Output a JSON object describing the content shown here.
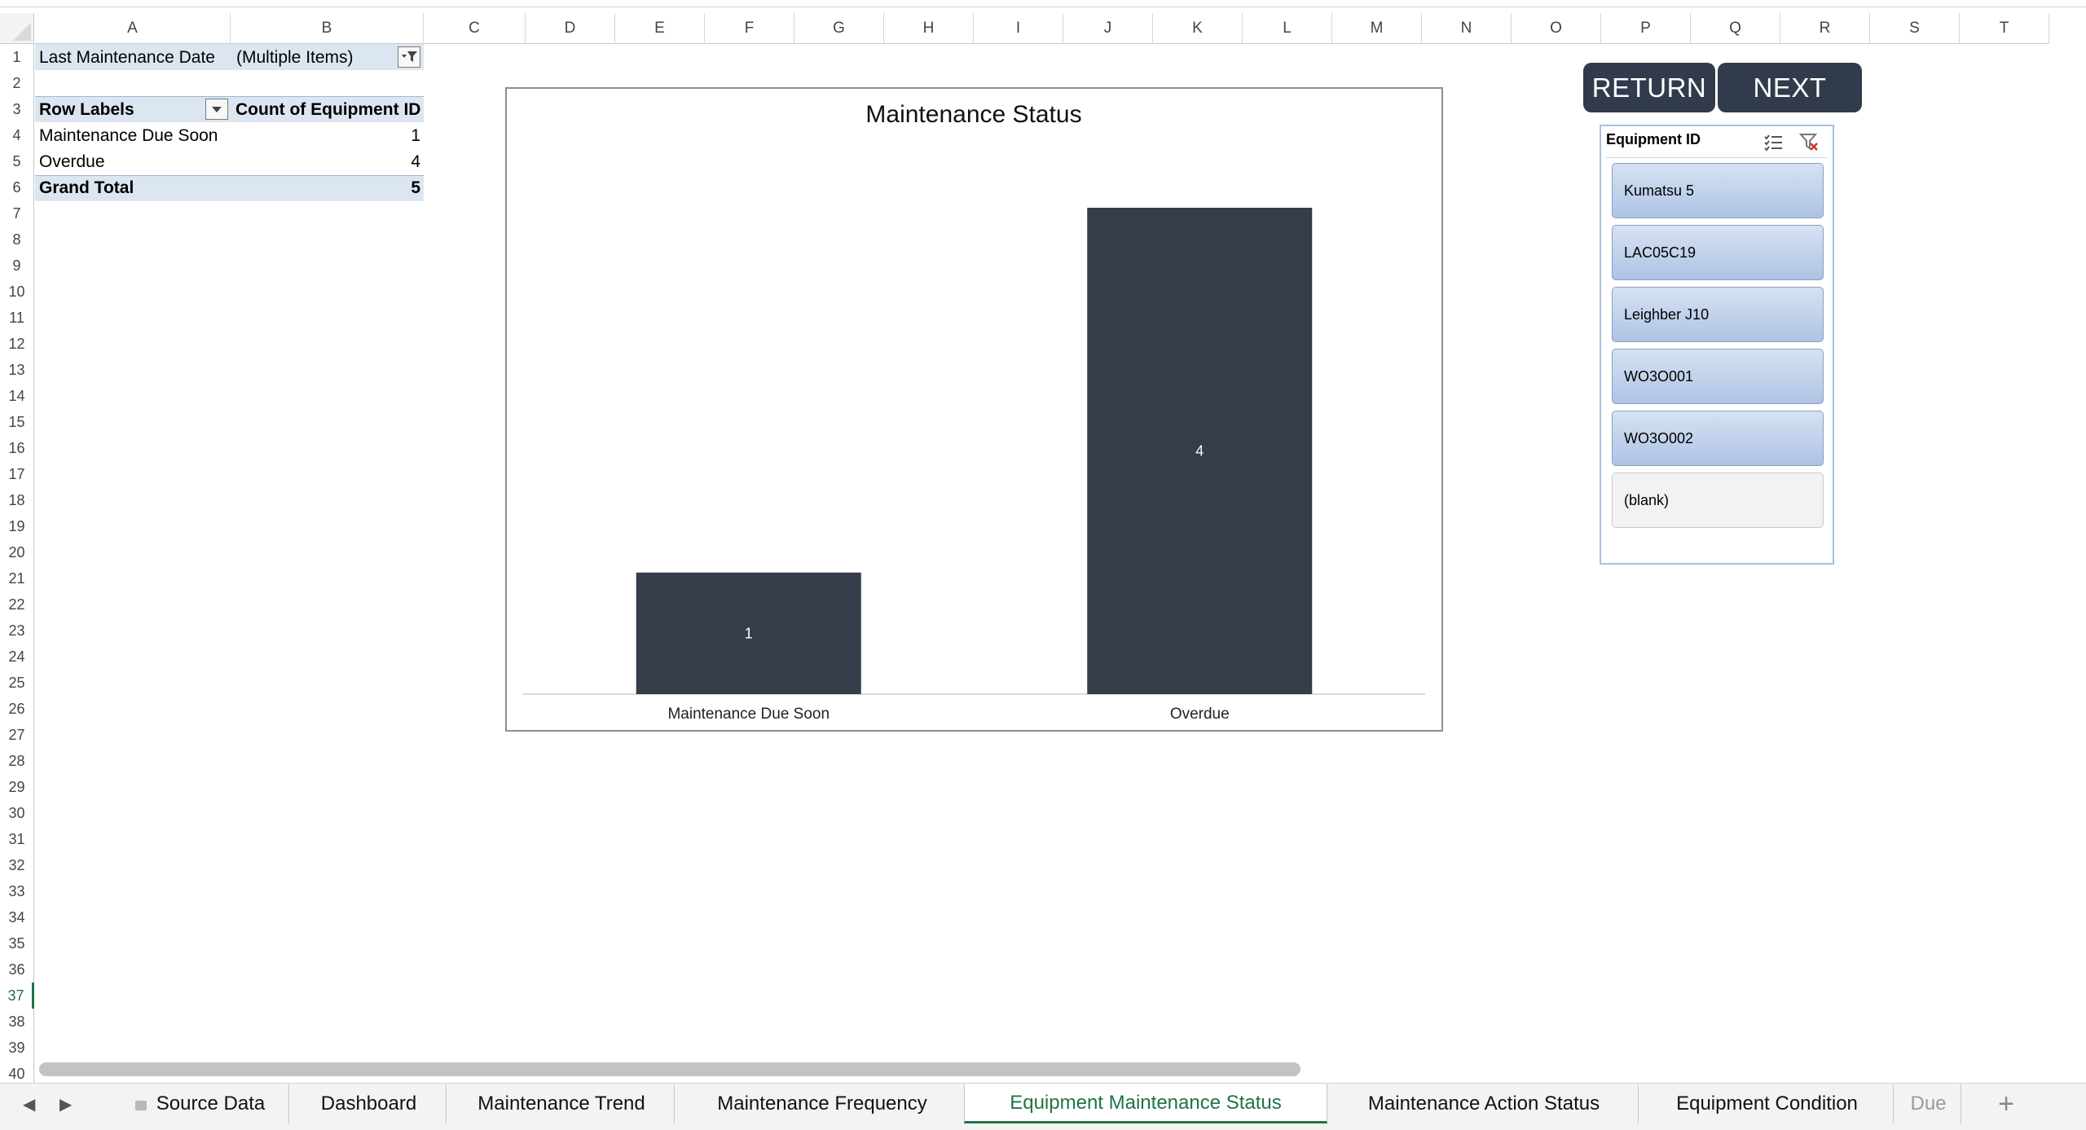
{
  "columns": [
    "A",
    "B",
    "C",
    "D",
    "E",
    "F",
    "G",
    "H",
    "I",
    "J",
    "K",
    "L",
    "M",
    "N",
    "O",
    "P",
    "Q",
    "R",
    "S",
    "T"
  ],
  "rows": [
    "1",
    "2",
    "3",
    "4",
    "5",
    "6",
    "7",
    "8",
    "9",
    "10",
    "11",
    "12",
    "13",
    "14",
    "15",
    "16",
    "17",
    "18",
    "19",
    "20",
    "21",
    "22",
    "23",
    "24",
    "25",
    "26",
    "27",
    "28",
    "29",
    "30",
    "31",
    "32",
    "33",
    "34",
    "35",
    "36",
    "37",
    "38",
    "39",
    "40"
  ],
  "active_row": "37",
  "pivot": {
    "filter_label": "Last Maintenance Date",
    "filter_value": "(Multiple Items)",
    "row_labels_header": "Row Labels",
    "value_header": "Count of Equipment ID",
    "rows": [
      {
        "label": "Maintenance Due Soon",
        "value": "1"
      },
      {
        "label": "Overdue",
        "value": "4"
      }
    ],
    "total_label": "Grand Total",
    "total_value": "5"
  },
  "chart_data": {
    "type": "bar",
    "title": "Maintenance Status",
    "categories": [
      "Maintenance Due Soon",
      "Overdue"
    ],
    "values": [
      1,
      4
    ],
    "data_labels": [
      "1",
      "4"
    ],
    "xlabel": "",
    "ylabel": "",
    "ylim": [
      0,
      4
    ],
    "grid": false,
    "legend": "none",
    "bar_color": "#353c4a"
  },
  "buttons": {
    "return_label": "RETURN",
    "next_label": "NEXT"
  },
  "slicer": {
    "title": "Equipment ID",
    "items": [
      {
        "label": "Kumatsu 5",
        "selected": true
      },
      {
        "label": "LAC05C19",
        "selected": true
      },
      {
        "label": "Leighber J10",
        "selected": true
      },
      {
        "label": "WO3O001",
        "selected": true
      },
      {
        "label": "WO3O002",
        "selected": true
      },
      {
        "label": "(blank)",
        "selected": false
      }
    ],
    "multiselect_icon": "multi-select-icon",
    "clear_filter_icon": "clear-filter-icon"
  },
  "tabs": [
    {
      "label": "Source Data",
      "locked": true
    },
    {
      "label": "Dashboard"
    },
    {
      "label": "Maintenance Trend"
    },
    {
      "label": "Maintenance Frequency"
    },
    {
      "label": "Equipment Maintenance Status",
      "active": true
    },
    {
      "label": "Maintenance Action Status"
    },
    {
      "label": "Equipment Condition"
    },
    {
      "label": "Due"
    }
  ],
  "colors": {
    "accent_green": "#217346",
    "pivot_header": "#dce6f1",
    "nav_button": "#323b4c",
    "slicer_selected": "#aec3e4"
  }
}
